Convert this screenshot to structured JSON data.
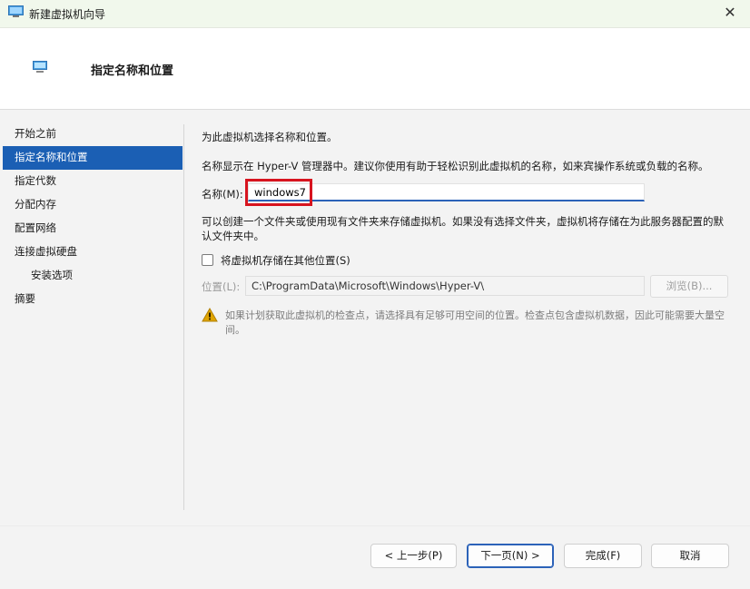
{
  "window": {
    "title": "新建虚拟机向导",
    "close_symbol": "✕"
  },
  "header": {
    "title": "指定名称和位置"
  },
  "nav": {
    "items": [
      {
        "label": "开始之前",
        "active": false,
        "sub": false
      },
      {
        "label": "指定名称和位置",
        "active": true,
        "sub": false
      },
      {
        "label": "指定代数",
        "active": false,
        "sub": false
      },
      {
        "label": "分配内存",
        "active": false,
        "sub": false
      },
      {
        "label": "配置网络",
        "active": false,
        "sub": false
      },
      {
        "label": "连接虚拟硬盘",
        "active": false,
        "sub": false
      },
      {
        "label": "安装选项",
        "active": false,
        "sub": true
      },
      {
        "label": "摘要",
        "active": false,
        "sub": false
      }
    ]
  },
  "content": {
    "intro": "为此虚拟机选择名称和位置。",
    "name_desc": "名称显示在 Hyper-V 管理器中。建议你使用有助于轻松识别此虚拟机的名称，如来宾操作系统或负载的名称。",
    "name_label": "名称(M):",
    "name_value": "windows7",
    "folder_desc": "可以创建一个文件夹或使用现有文件夹来存储虚拟机。如果没有选择文件夹，虚拟机将存储在为此服务器配置的默认文件夹中。",
    "checkbox_label": "将虚拟机存储在其他位置(S)",
    "location_label": "位置(L):",
    "location_value": "C:\\ProgramData\\Microsoft\\Windows\\Hyper-V\\",
    "browse_label": "浏览(B)...",
    "warning": "如果计划获取此虚拟机的检查点，请选择具有足够可用空间的位置。检查点包含虚拟机数据，因此可能需要大量空间。"
  },
  "footer": {
    "prev_label": "< 上一步(P)",
    "next_label": "下一页(N) >",
    "finish_label": "完成(F)",
    "cancel_label": "取消"
  },
  "colors": {
    "accent": "#1b5fb4",
    "highlight": "#d7141f",
    "warning": "#e0a400"
  }
}
